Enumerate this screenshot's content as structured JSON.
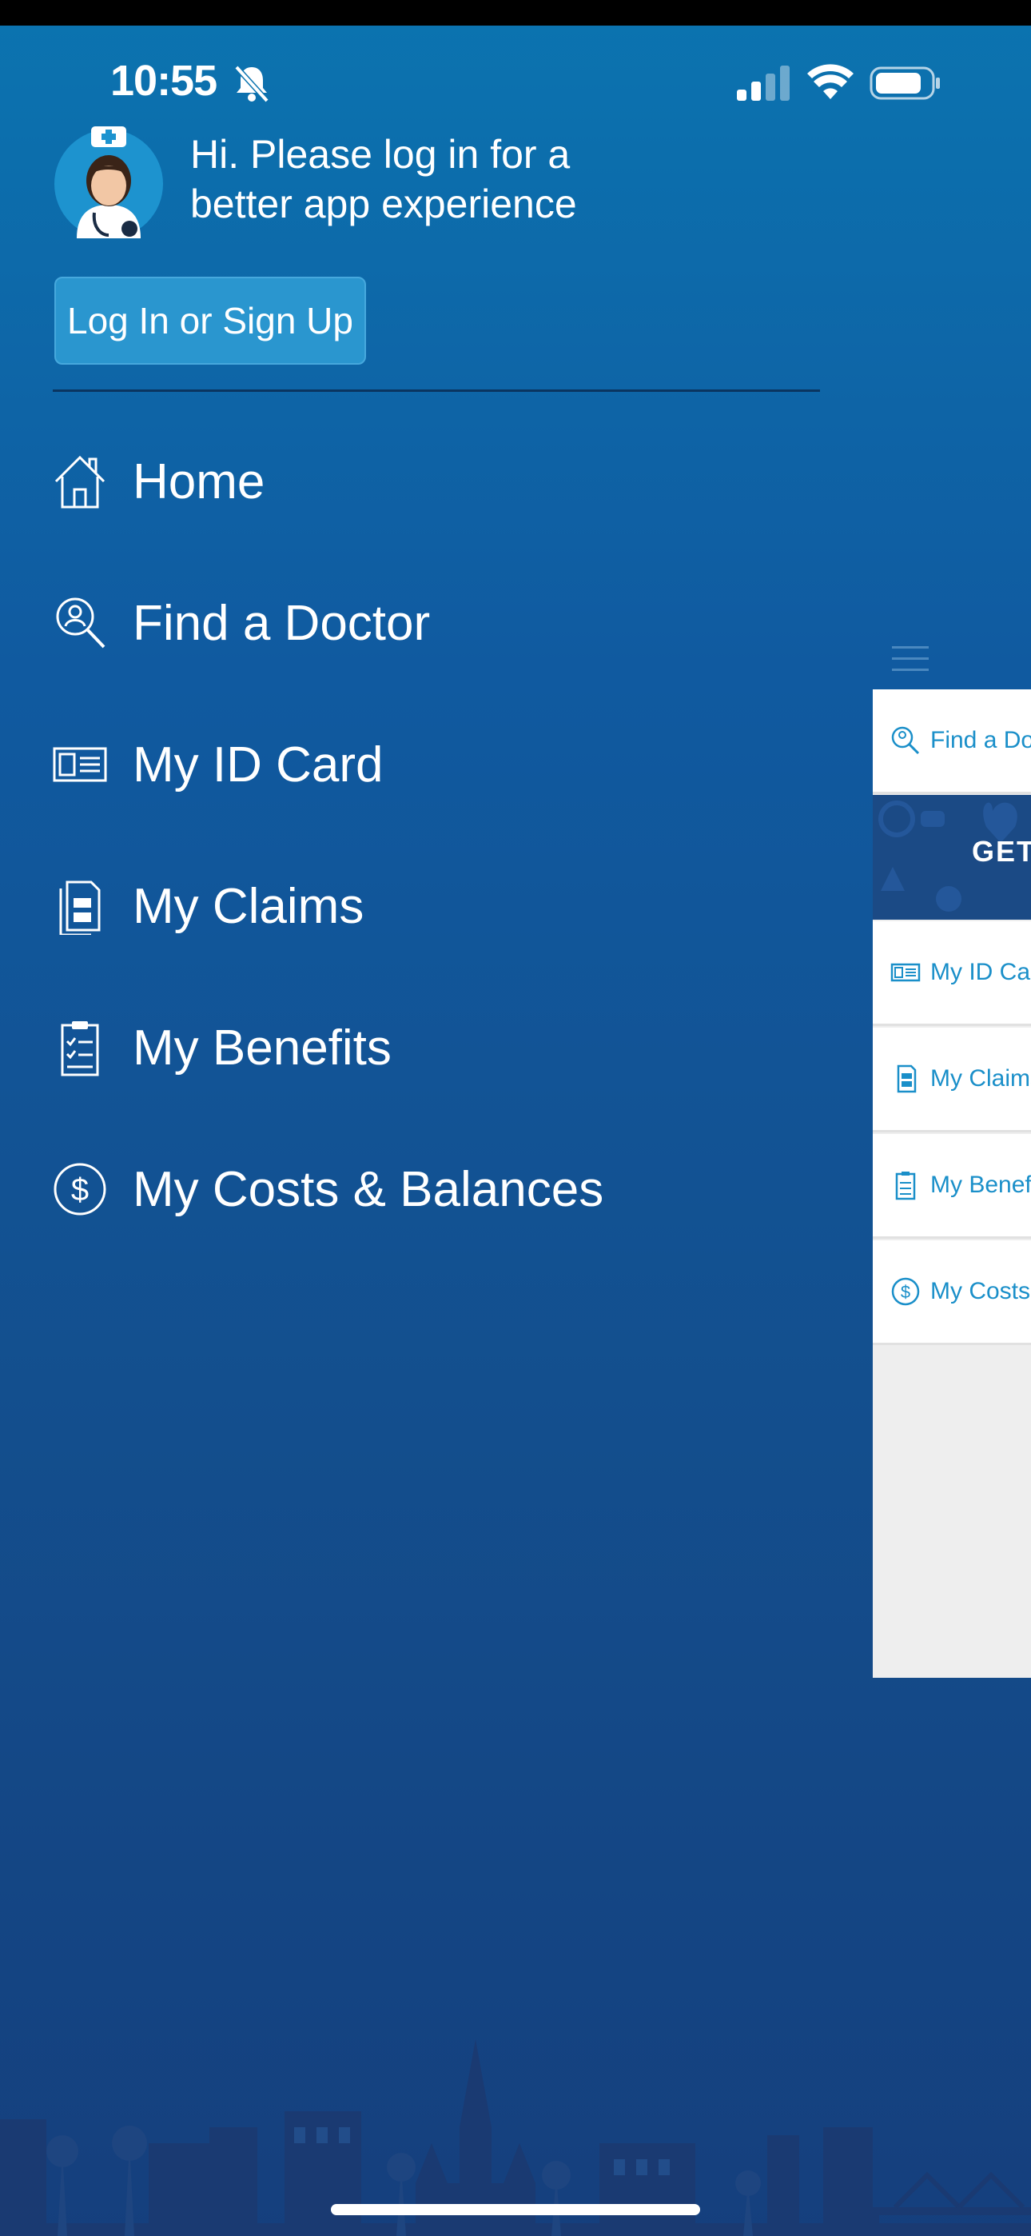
{
  "status_bar": {
    "time": "10:55"
  },
  "header": {
    "greeting": "Hi. Please log in for a better app experience",
    "login_button": "Log In or Sign Up"
  },
  "menu": {
    "items": [
      {
        "label": "Home",
        "icon": "home-icon"
      },
      {
        "label": "Find a Doctor",
        "icon": "find-doctor-icon"
      },
      {
        "label": "My ID Card",
        "icon": "id-card-icon"
      },
      {
        "label": "My Claims",
        "icon": "claims-icon"
      },
      {
        "label": "My Benefits",
        "icon": "benefits-icon"
      },
      {
        "label": "My Costs & Balances",
        "icon": "dollar-icon"
      }
    ]
  },
  "background_screen": {
    "items": [
      {
        "label": "Find a Do"
      },
      {
        "label": "My ID Car"
      },
      {
        "label": "My Claims"
      },
      {
        "label": "My Benef"
      },
      {
        "label": "My Costs"
      }
    ],
    "banner_text": "GET"
  },
  "colors": {
    "background_top": "#0b74b0",
    "background_bottom": "#153f7d",
    "button": "#2a96cf",
    "peek_accent": "#1a8fc9"
  }
}
